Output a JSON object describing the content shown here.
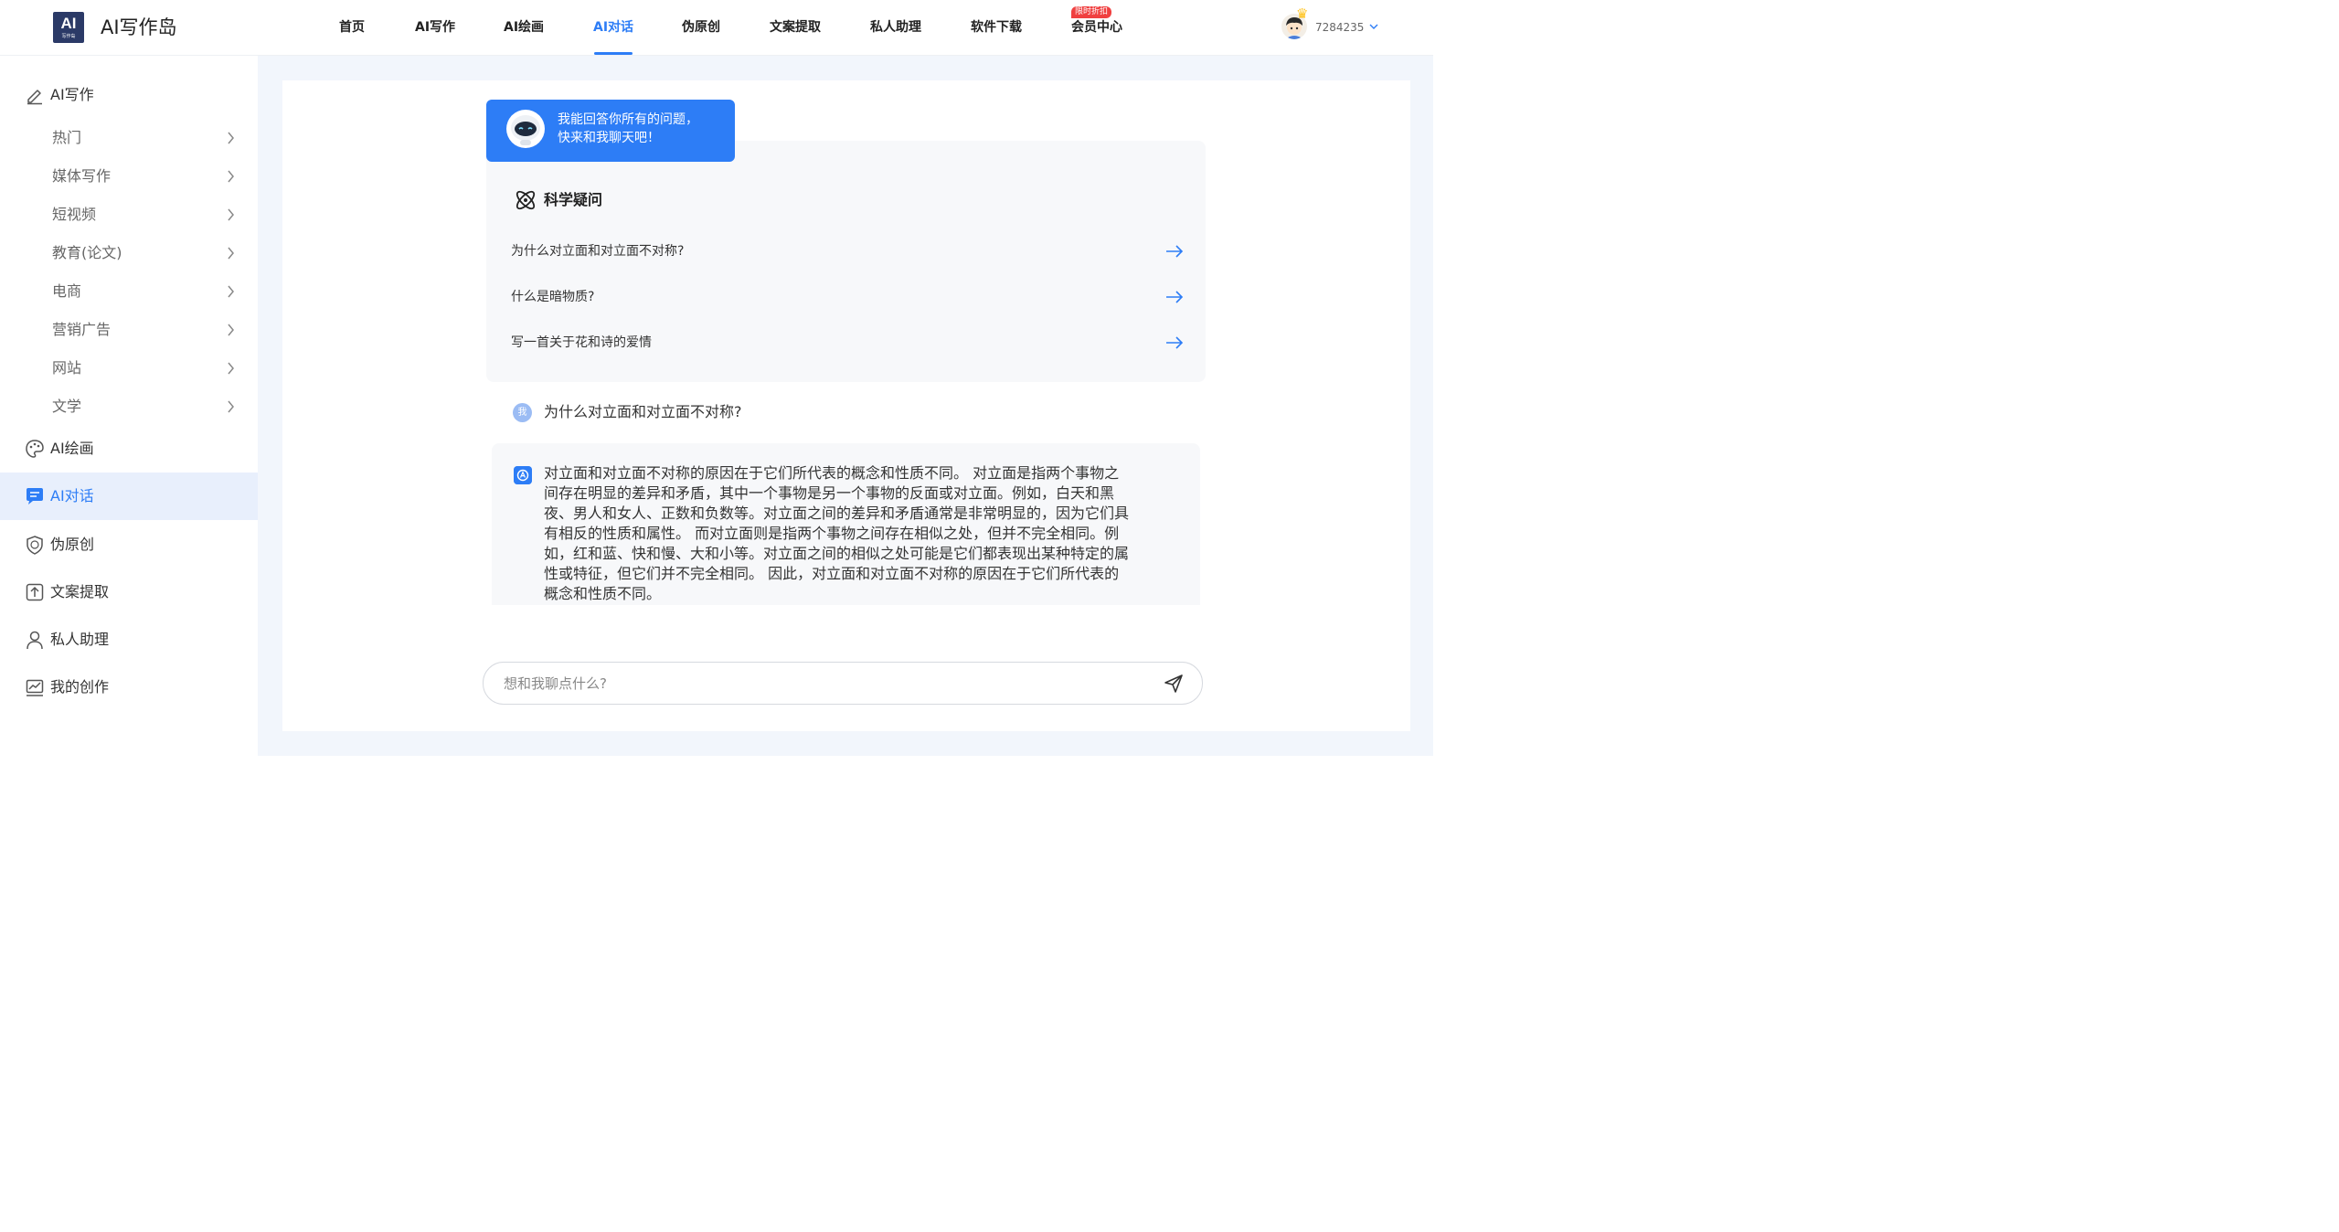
{
  "header": {
    "logo_text": "AI",
    "logo_subtext": "写作岛",
    "app_title": "AI写作岛",
    "nav": [
      {
        "label": "首页"
      },
      {
        "label": "AI写作"
      },
      {
        "label": "AI绘画"
      },
      {
        "label": "AI对话",
        "active": true
      },
      {
        "label": "伪原创"
      },
      {
        "label": "文案提取"
      },
      {
        "label": "私人助理"
      },
      {
        "label": "软件下载"
      },
      {
        "label": "会员中心"
      }
    ],
    "nav_badge": "限时折扣",
    "user_id": "7284235"
  },
  "sidebar": {
    "writing": {
      "label": "AI写作",
      "icon": "pen-icon"
    },
    "writing_subs": [
      {
        "label": "热门"
      },
      {
        "label": "媒体写作"
      },
      {
        "label": "短视频"
      },
      {
        "label": "教育(论文)"
      },
      {
        "label": "电商"
      },
      {
        "label": "营销广告"
      },
      {
        "label": "网站"
      },
      {
        "label": "文学"
      }
    ],
    "items": [
      {
        "label": "AI绘画",
        "icon": "palette-icon"
      },
      {
        "label": "AI对话",
        "icon": "chat-icon",
        "active": true
      },
      {
        "label": "伪原创",
        "icon": "shield-icon"
      },
      {
        "label": "文案提取",
        "icon": "upload-icon"
      },
      {
        "label": "私人助理",
        "icon": "person-icon"
      },
      {
        "label": "我的创作",
        "icon": "chart-icon"
      }
    ]
  },
  "chat": {
    "bot_greeting_line1": "我能回答你所有的问题，",
    "bot_greeting_line2": "快来和我聊天吧！",
    "topic_title": "科学疑问",
    "questions": [
      "为什么对立面和对立面不对称?",
      "什么是暗物质?",
      "写一首关于花和诗的爱情"
    ],
    "user_avatar_label": "我",
    "user_message": "为什么对立面和对立面不对称?",
    "answer": "对立面和对立面不对称的原因在于它们所代表的概念和性质不同。 对立面是指两个事物之间存在明显的差异和矛盾，其中一个事物是另一个事物的反面或对立面。例如，白天和黑夜、男人和女人、正数和负数等。对立面之间的差异和矛盾通常是非常明显的，因为它们具有相反的性质和属性。 而对立面则是指两个事物之间存在相似之处，但并不完全相同。例如，红和蓝、快和慢、大和小等。对立面之间的相似之处可能是它们都表现出某种特定的属性或特征，但它们并不完全相同。 因此，对立面和对立面不对称的原因在于它们所代表的概念和性质不同。",
    "input_placeholder": "想和我聊点什么?"
  },
  "colors": {
    "accent": "#2d7df6",
    "logo_bg": "#2b3a67",
    "badge": "#f04040",
    "app_bg": "#f2f6fc",
    "active_sidebar_bg": "#e8effc"
  }
}
